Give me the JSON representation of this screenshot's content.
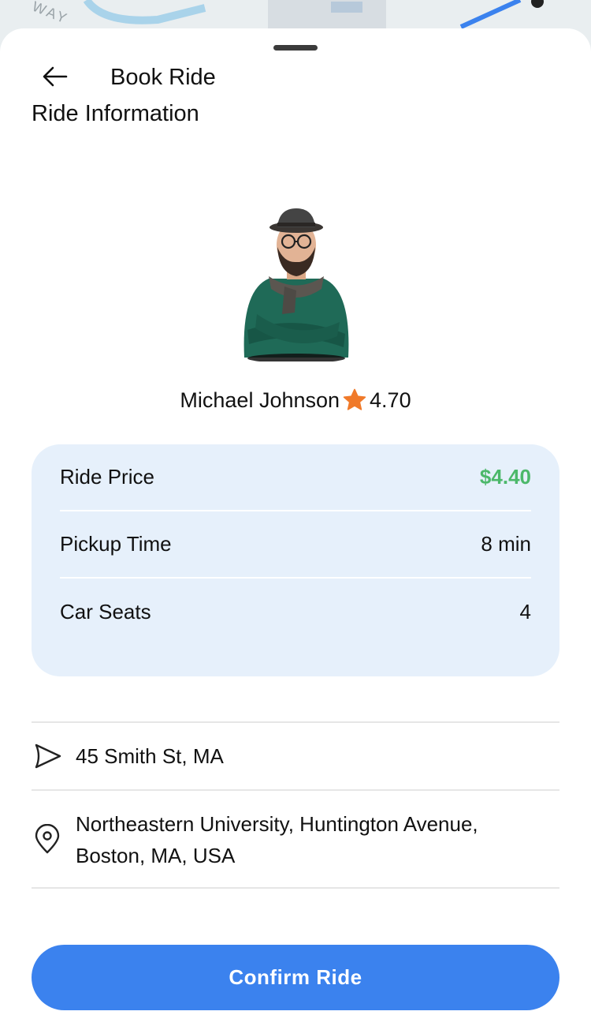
{
  "header": {
    "title": "Book Ride",
    "section_title": "Ride Information"
  },
  "driver": {
    "name": "Michael Johnson",
    "rating": "4.70"
  },
  "ride_info": {
    "rows": [
      {
        "label": "Ride Price",
        "value": "$4.40"
      },
      {
        "label": "Pickup Time",
        "value": "8 min"
      },
      {
        "label": "Car Seats",
        "value": "4"
      }
    ]
  },
  "locations": {
    "pickup": "45 Smith St, MA",
    "destination": "Northeastern University, Huntington Avenue, Boston, MA, USA"
  },
  "actions": {
    "confirm_label": "Confirm Ride"
  },
  "map": {
    "road_label": "WAY"
  },
  "colors": {
    "accent": "#3b82ee",
    "price": "#4cb86a",
    "card_bg": "#e6f0fb",
    "star": "#f07a2a"
  },
  "icons": {
    "back": "arrow-left-icon",
    "star": "star-icon",
    "pickup": "navigation-icon",
    "destination": "map-pin-icon"
  }
}
